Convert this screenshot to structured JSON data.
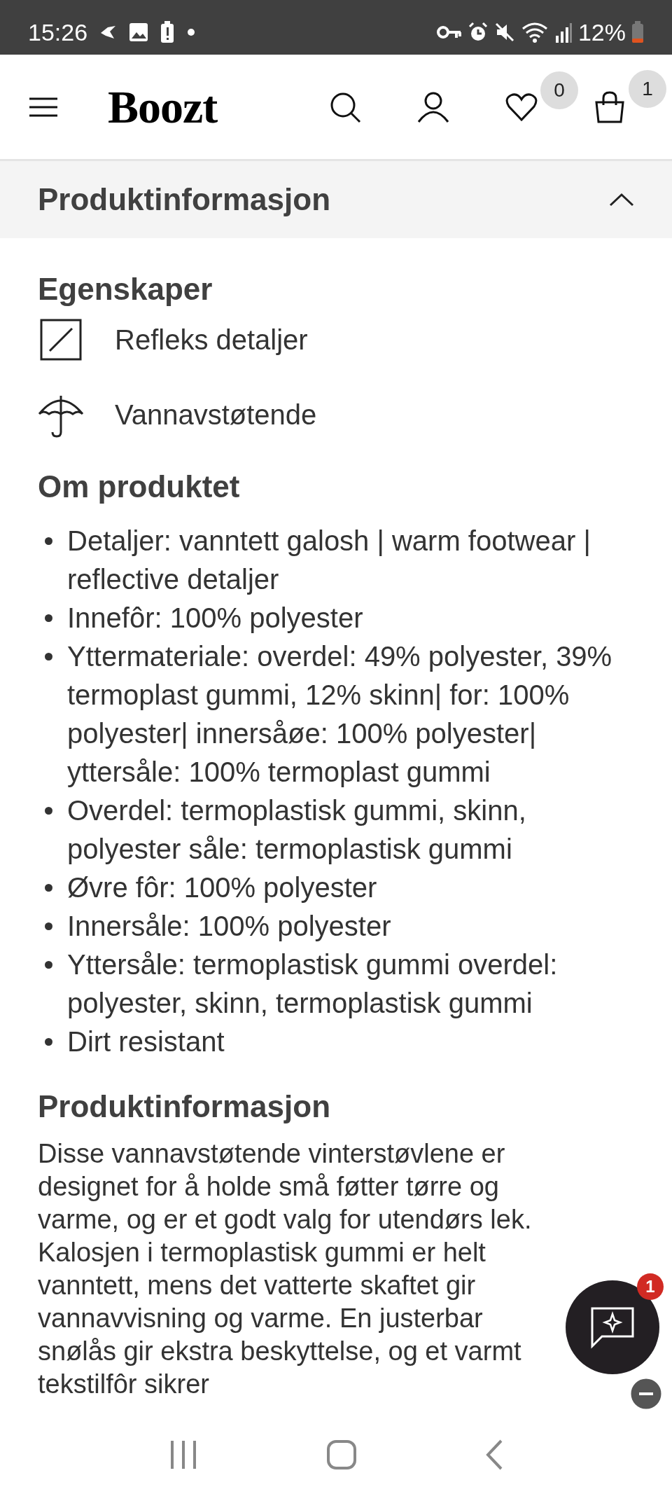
{
  "status_bar": {
    "time": "15:26",
    "battery": "12%"
  },
  "header": {
    "logo": "Boozt",
    "wishlist_count": "0",
    "cart_count": "1"
  },
  "accordion": {
    "title": "Produktinformasjon",
    "expanded": true
  },
  "features": {
    "heading": "Egenskaper",
    "items": [
      {
        "label": "Refleks detaljer",
        "kind": "reflective"
      },
      {
        "label": "Vannavstøtende",
        "kind": "umbrella"
      }
    ]
  },
  "about": {
    "heading": "Om produktet",
    "bullets": [
      "Detaljer: vanntett galosh | warm footwear | reflective detaljer",
      "Innefôr: 100% polyester",
      "Yttermateriale: overdel: 49% polyester, 39% termoplast gummi, 12% skinn| for: 100% polyester| innersåøe: 100% polyester| yttersåle: 100% termoplast gummi",
      "Overdel: termoplastisk gummi, skinn, polyester såle: termoplastisk gummi",
      "Øvre fôr: 100% polyester",
      "Innersåle: 100% polyester",
      "Yttersåle: termoplastisk gummi overdel: polyester, skinn, termoplastisk gummi",
      "Dirt resistant"
    ]
  },
  "description": {
    "heading": "Produktinformasjon",
    "text": "Disse vannavstøtende vinterstøvlene er designet for å holde små føtter tørre og varme, og er et godt valg for utendørs lek. Kalosjen i termoplastisk gummi er helt vanntett, mens det vatterte skaftet gir vannavvisning og varme. En justerbar snølås gir ekstra beskyttelse, og et varmt tekstilfôr sikrer"
  },
  "chat": {
    "badge": "1"
  }
}
